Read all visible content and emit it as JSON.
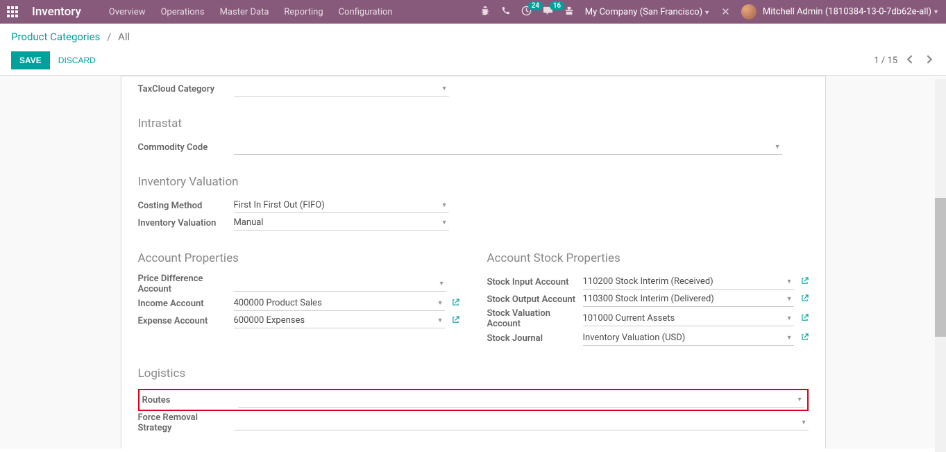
{
  "topbar": {
    "brand": "Inventory",
    "menu": [
      "Overview",
      "Operations",
      "Master Data",
      "Reporting",
      "Configuration"
    ],
    "badge_activity": "24",
    "badge_discuss": "16",
    "company": "My Company (San Francisco)",
    "user": "Mitchell Admin (1810384-13-0-7db62e-all)"
  },
  "breadcrumb": {
    "root": "Product Categories",
    "current": "All"
  },
  "buttons": {
    "save": "SAVE",
    "discard": "DISCARD"
  },
  "pager": {
    "text": "1 / 15"
  },
  "sections": {
    "taxcloud_label": "TaxCloud Category",
    "intrastat_title": "Intrastat",
    "commodity_label": "Commodity Code",
    "inventory_valuation_title": "Inventory Valuation",
    "costing_method_label": "Costing Method",
    "costing_method_value": "First In First Out (FIFO)",
    "inventory_valuation_label": "Inventory Valuation",
    "inventory_valuation_value": "Manual",
    "account_props_title": "Account Properties",
    "price_diff_label": "Price Difference Account",
    "income_label": "Income Account",
    "income_value": "400000 Product Sales",
    "expense_label": "Expense Account",
    "expense_value": "600000 Expenses",
    "stock_props_title": "Account Stock Properties",
    "stock_input_label": "Stock Input Account",
    "stock_input_value": "110200 Stock Interim (Received)",
    "stock_output_label": "Stock Output Account",
    "stock_output_value": "110300 Stock Interim (Delivered)",
    "stock_valuation_label": "Stock Valuation Account",
    "stock_valuation_value": "101000 Current Assets",
    "stock_journal_label": "Stock Journal",
    "stock_journal_value": "Inventory Valuation (USD)",
    "logistics_title": "Logistics",
    "routes_label": "Routes",
    "force_removal_label": "Force Removal Strategy"
  }
}
